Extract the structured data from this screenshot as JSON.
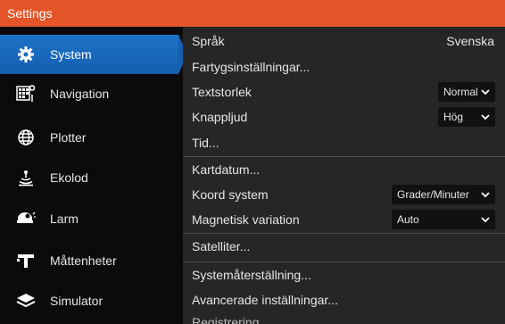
{
  "window": {
    "title": "Settings"
  },
  "sidebar": {
    "items": [
      {
        "label": "System",
        "icon": "gear-icon",
        "active": true
      },
      {
        "label": "Navigation",
        "icon": "navigation-icon",
        "active": false
      },
      {
        "label": "Plotter",
        "icon": "globe-icon",
        "active": false
      },
      {
        "label": "Ekolod",
        "icon": "echosounder-icon",
        "active": false
      },
      {
        "label": "Larm",
        "icon": "alarm-icon",
        "active": false
      },
      {
        "label": "Måttenheter",
        "icon": "units-icon",
        "active": false
      },
      {
        "label": "Simulator",
        "icon": "layers-icon",
        "active": false
      }
    ]
  },
  "settings": {
    "sprak_label": "Språk",
    "sprak_value": "Svenska",
    "fartyg_label": "Fartygsinställningar...",
    "textstorlek_label": "Textstorlek",
    "textstorlek_value": "Normal",
    "knappljud_label": "Knappljud",
    "knappljud_value": "Hög",
    "tid_label": "Tid...",
    "kartdatum_label": "Kartdatum...",
    "koord_label": "Koord system",
    "koord_value": "Grader/Minuter",
    "magnetisk_label": "Magnetisk variation",
    "magnetisk_value": "Auto",
    "satelliter_label": "Satelliter...",
    "systemater_label": "Systemåterställning...",
    "avancerade_label": "Avancerade inställningar...",
    "registrering_label": "Registrering..."
  },
  "colors": {
    "accent": "#e4562a",
    "active": "#1e72c9"
  }
}
